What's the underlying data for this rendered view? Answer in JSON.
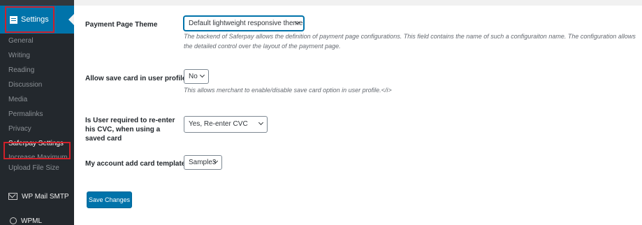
{
  "sidebar": {
    "settings_label": "Settings",
    "submenu": [
      "General",
      "Writing",
      "Reading",
      "Discussion",
      "Media",
      "Permalinks",
      "Privacy",
      "Saferpay Settings",
      "Increase Maximum Upload File Size"
    ],
    "wp_mail_smtp": "WP Mail SMTP",
    "wpml": "WPML"
  },
  "form": {
    "theme": {
      "label": "Payment Page Theme",
      "value": "Default lightweight responsive theme",
      "description": "The backend of Saferpay allows the definition of payment page configurations. This field contains the name of such a configuraiton name. The configuration allows the detailed control over the layout of the payment page."
    },
    "save_card": {
      "label": "Allow save card in user profile",
      "value": "No",
      "description": "This allows merchant to enable/disable save card option in user profile.</i>"
    },
    "cvc": {
      "label": "Is User required to re-enter his CVC, when using a saved card",
      "value": "Yes, Re-enter CVC"
    },
    "template": {
      "label": "My account add card template",
      "value": "Sample3"
    },
    "save_button": "Save Changes"
  },
  "colors": {
    "sidebar_bg": "#23282d",
    "accent": "#0073aa",
    "highlight_box": "#d0202a"
  }
}
